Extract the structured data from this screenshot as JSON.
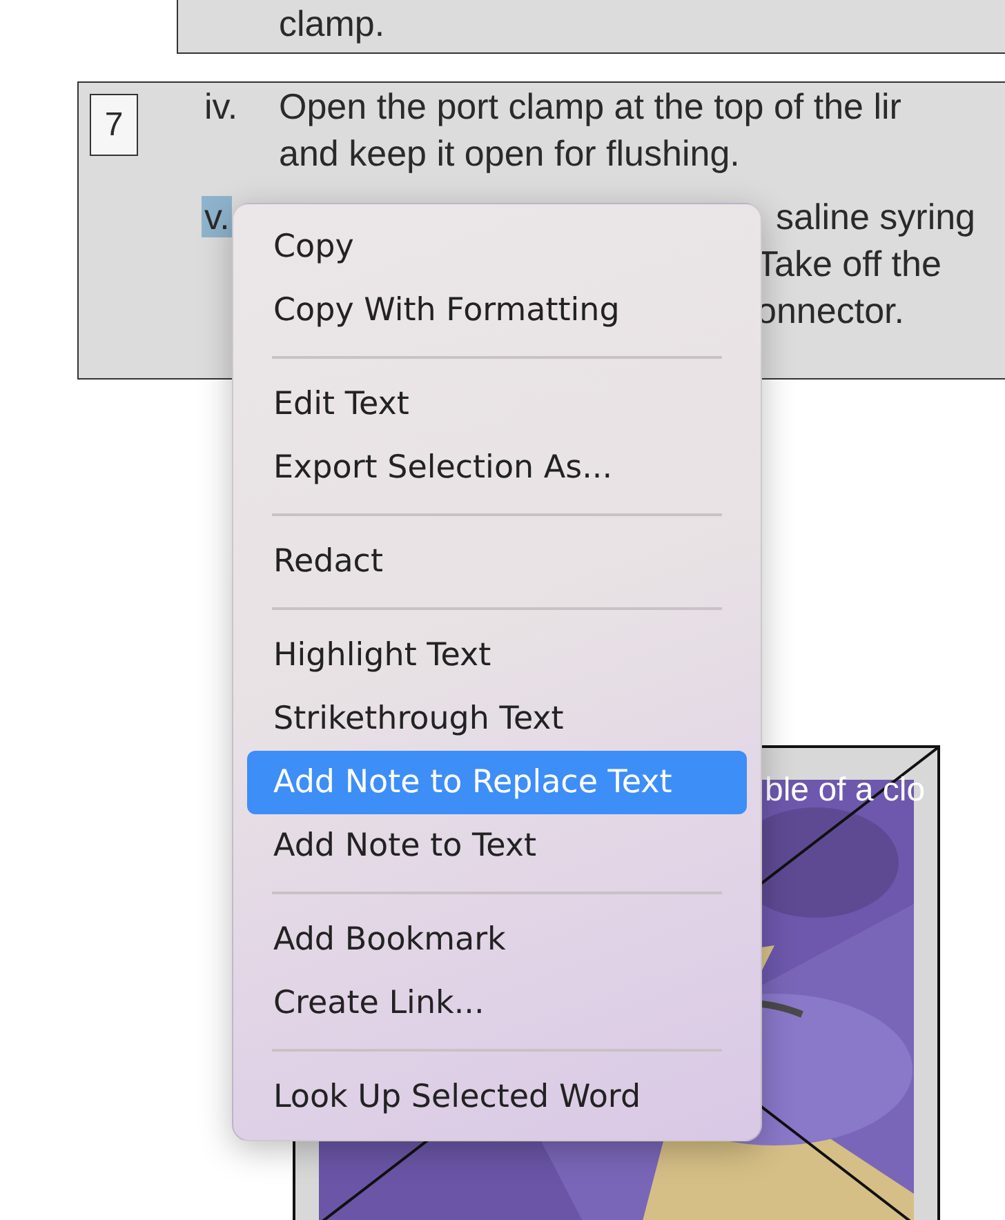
{
  "document": {
    "blocks": [
      {
        "items": [
          {
            "lines": [
              "clamp."
            ]
          }
        ]
      },
      {
        "step": "7",
        "items": [
          {
            "numeral": "iv.",
            "selected": false,
            "lines": [
              "Open the port clamp at the top of the lir",
              "and keep it open for flushing."
            ]
          },
          {
            "numeral": "v.",
            "selected": true,
            "lines": [
              "saline syring",
              "Take off the",
              "onnector."
            ]
          }
        ]
      }
    ],
    "figure": {
      "kind": "picture",
      "caption": "ble of a clo"
    }
  },
  "context_menu": {
    "items": [
      {
        "kind": "item",
        "label": "Copy",
        "selected": false
      },
      {
        "kind": "item",
        "label": "Copy With Formatting",
        "selected": false
      },
      {
        "kind": "separator"
      },
      {
        "kind": "item",
        "label": "Edit Text",
        "selected": false
      },
      {
        "kind": "item",
        "label": "Export Selection As...",
        "selected": false
      },
      {
        "kind": "separator"
      },
      {
        "kind": "item",
        "label": "Redact",
        "selected": false
      },
      {
        "kind": "separator"
      },
      {
        "kind": "item",
        "label": "Highlight Text",
        "selected": false
      },
      {
        "kind": "item",
        "label": "Strikethrough Text",
        "selected": false
      },
      {
        "kind": "item",
        "label": "Add Note to Replace Text",
        "selected": true
      },
      {
        "kind": "item",
        "label": "Add Note to Text",
        "selected": false
      },
      {
        "kind": "separator"
      },
      {
        "kind": "item",
        "label": "Add Bookmark",
        "selected": false
      },
      {
        "kind": "item",
        "label": "Create Link...",
        "selected": false
      },
      {
        "kind": "separator"
      },
      {
        "kind": "item",
        "label": "Look Up Selected Word",
        "selected": false
      }
    ]
  }
}
